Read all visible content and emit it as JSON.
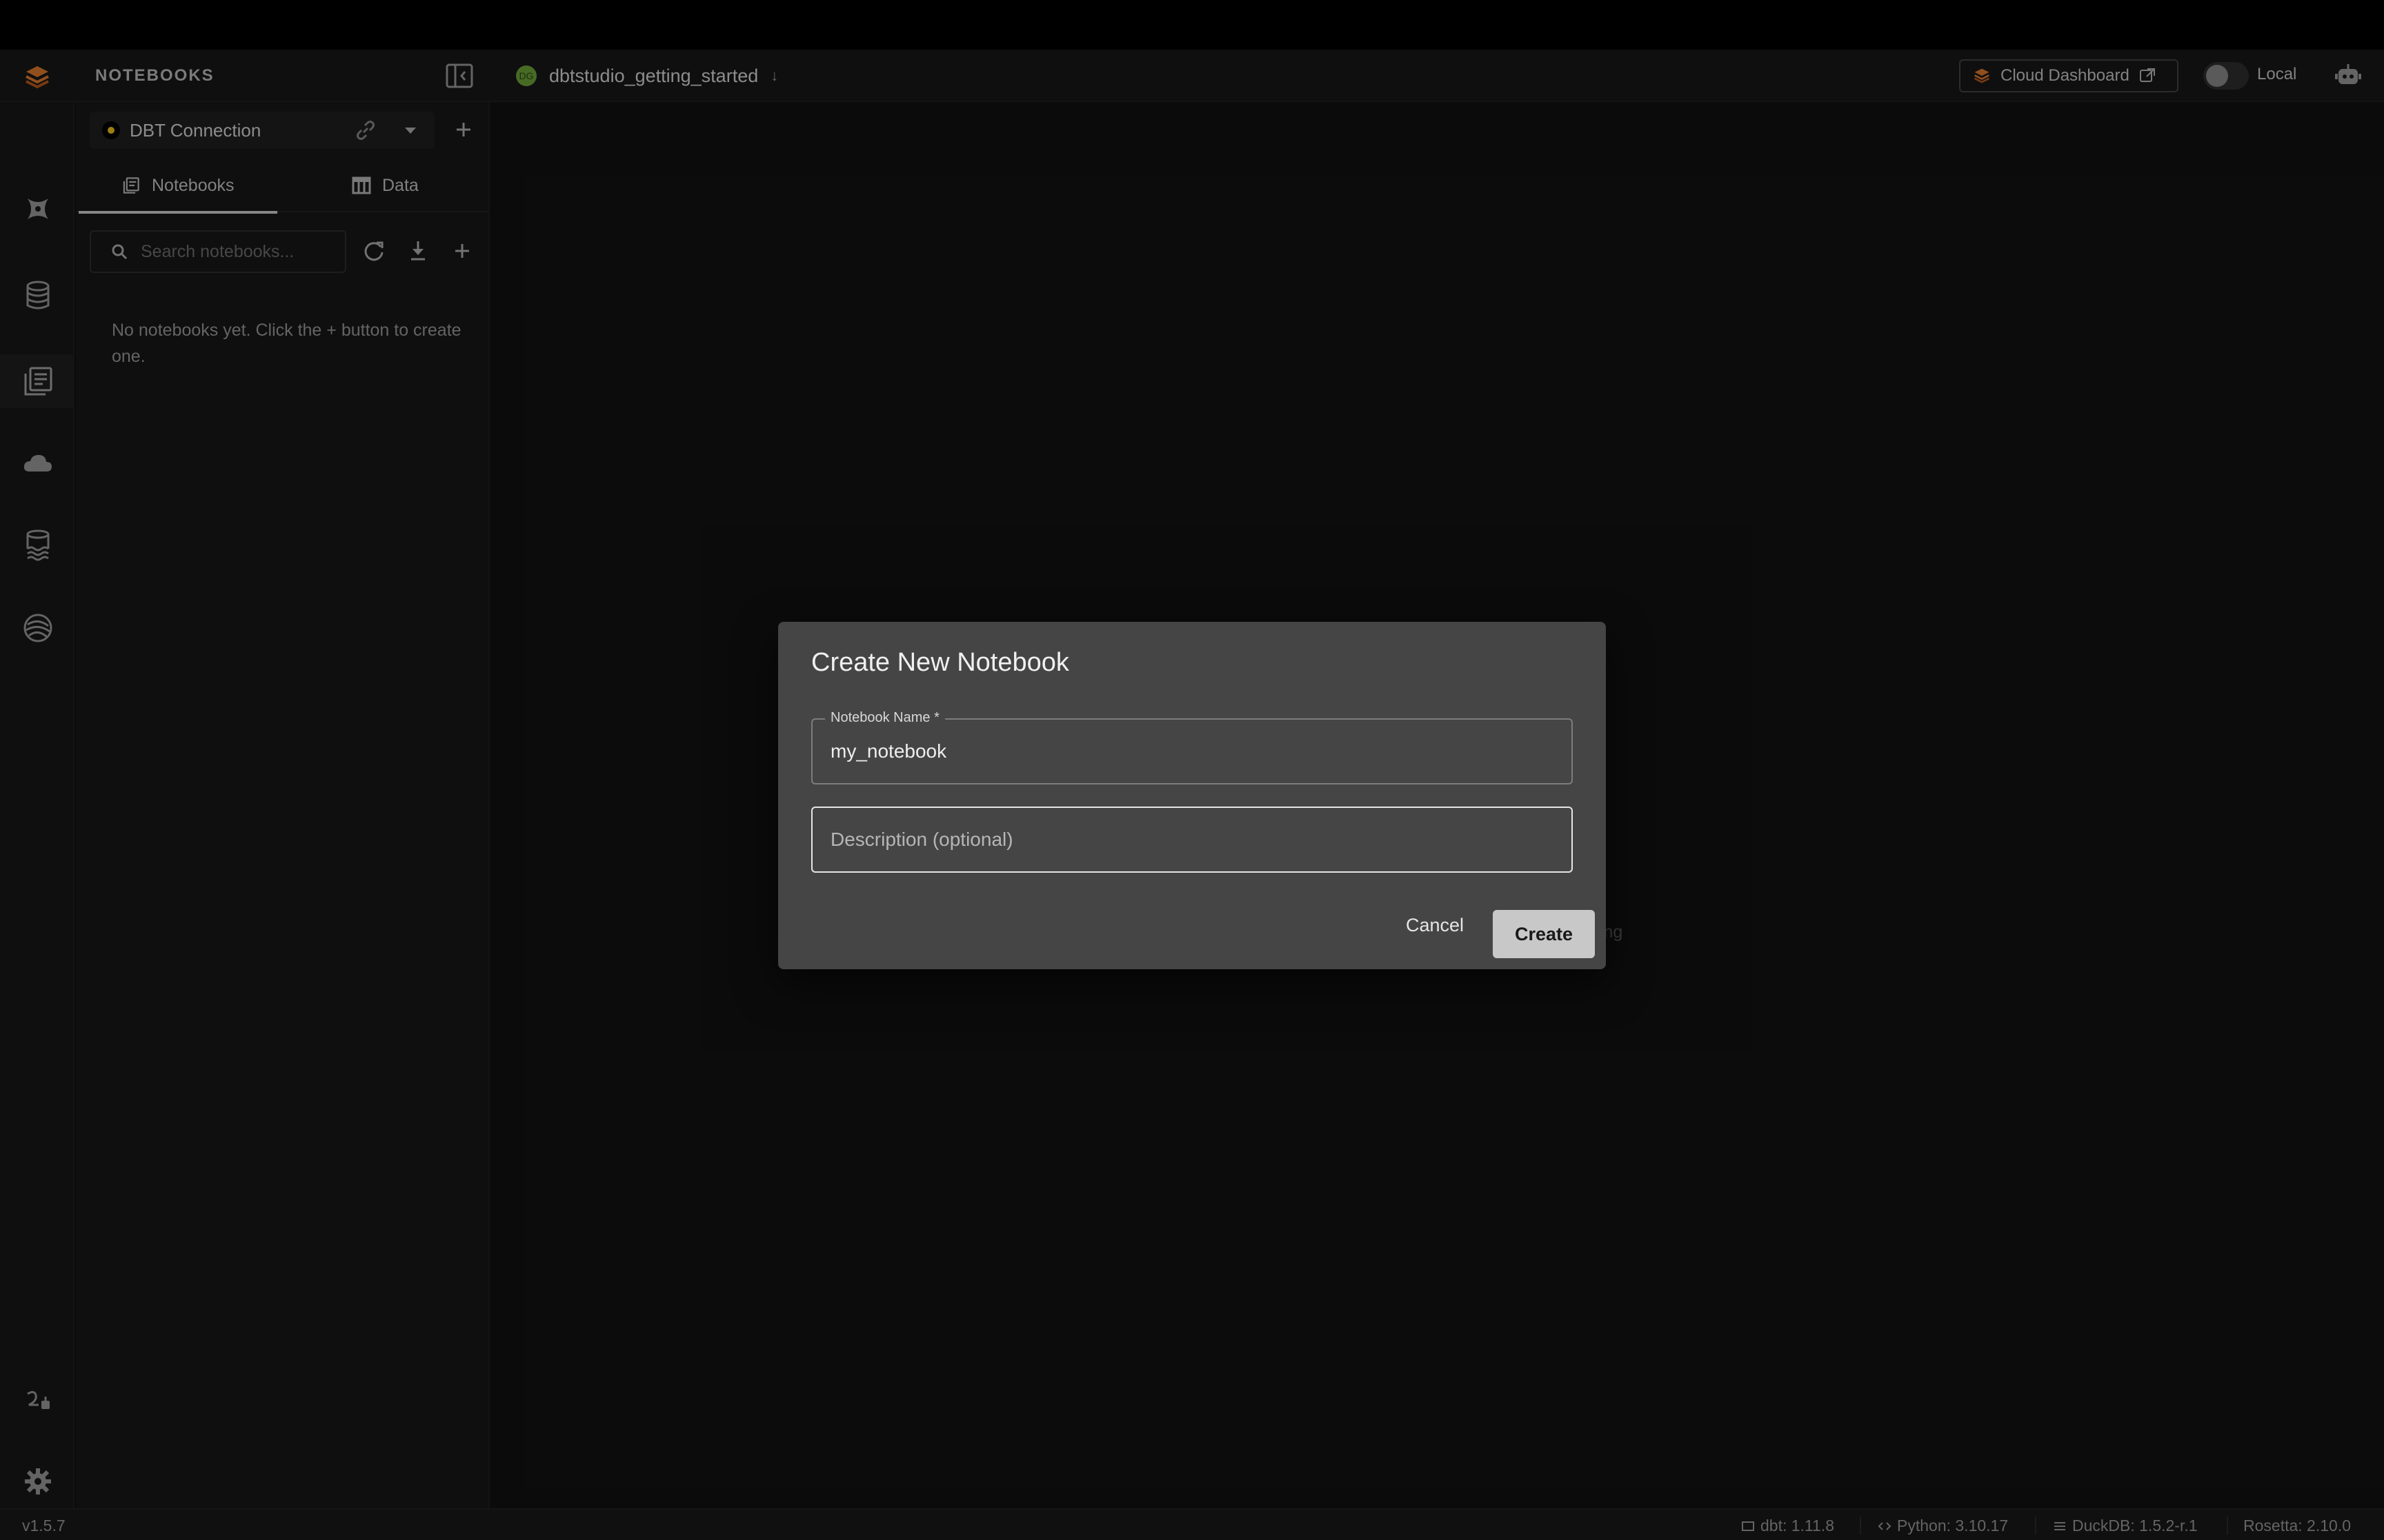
{
  "header": {
    "section_title": "NOTEBOOKS",
    "project_initials": "DG",
    "project_name": "dbtstudio_getting_started",
    "cloud_dashboard_label": "Cloud Dashboard",
    "mode_label": "Local"
  },
  "rail": {
    "icons": [
      "dbt-icon",
      "database-icon",
      "notebooks-icon",
      "cloud-icon",
      "data-lake-icon",
      "rosetta-icon",
      "connections-icon",
      "settings-icon"
    ],
    "active": "notebooks-icon"
  },
  "panel": {
    "connection_name": "DBT Connection",
    "tabs": [
      {
        "label": "Notebooks",
        "active": true
      },
      {
        "label": "Data",
        "active": false
      }
    ],
    "search_placeholder": "Search notebooks...",
    "empty_message": "No notebooks yet. Click the + button to create one."
  },
  "main": {
    "background_text_fragment": "ting"
  },
  "status": {
    "version": "v1.5.7",
    "dbt": "dbt: 1.11.8",
    "python": "Python: 3.10.17",
    "duckdb": "DuckDB: 1.5.2-r.1",
    "rosetta": "Rosetta: 2.10.0"
  },
  "dialog": {
    "title": "Create New Notebook",
    "name_label": "Notebook Name *",
    "name_value": "my_notebook",
    "description_placeholder": "Description (optional)",
    "cancel_label": "Cancel",
    "create_label": "Create"
  },
  "colors": {
    "accent_orange": "#e07a2e",
    "project_green": "#6da33a",
    "connection_yellow": "#f2c420"
  }
}
